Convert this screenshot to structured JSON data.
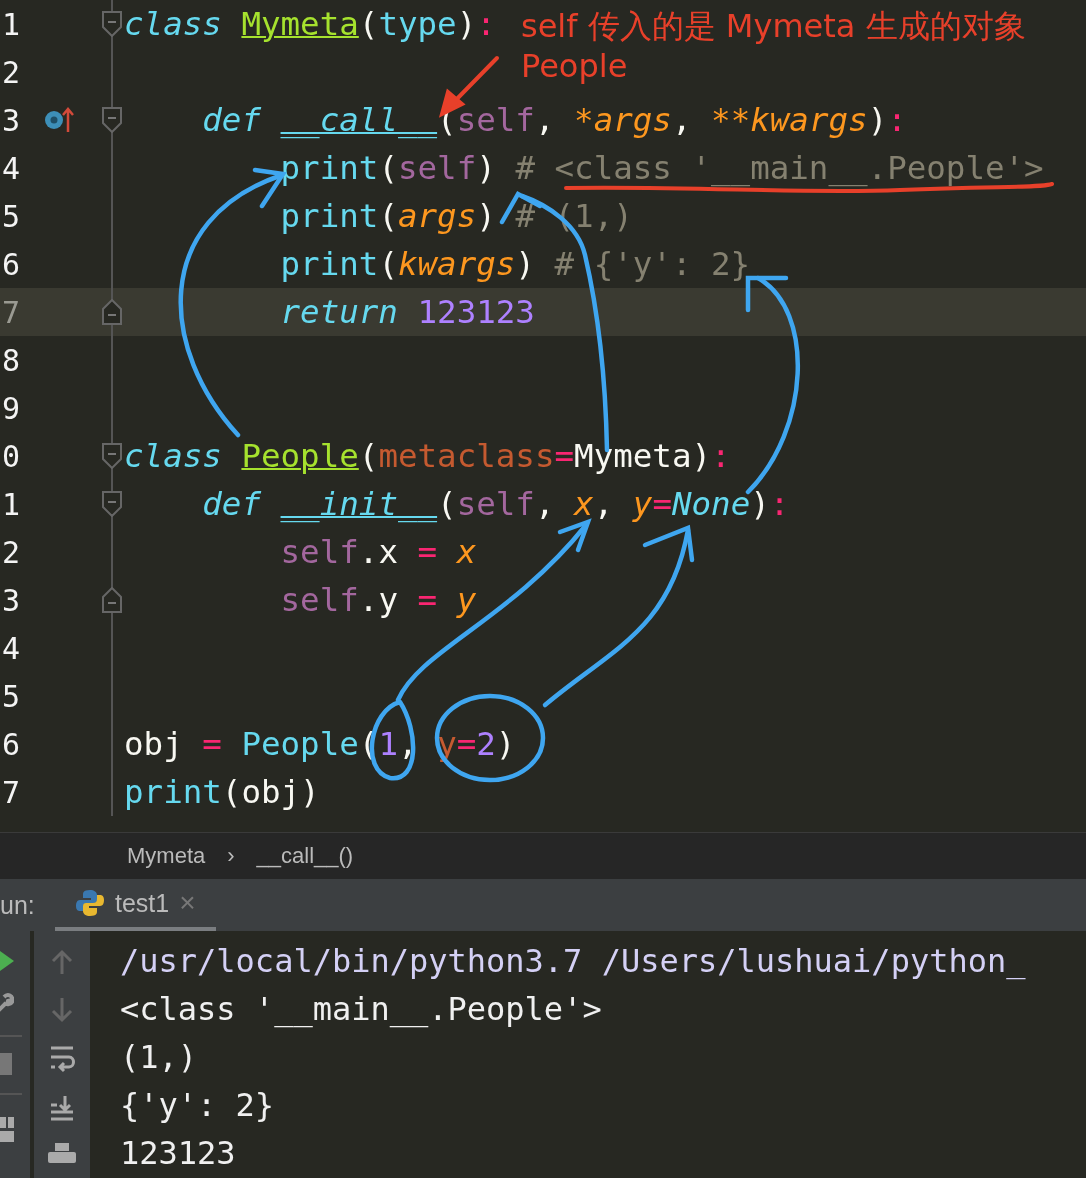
{
  "editor": {
    "lines": [
      {
        "number": "1",
        "current": false,
        "fold_start": true,
        "fold_end": false,
        "override_marker": false,
        "tokens": [
          {
            "text": "class ",
            "kind": "keyword"
          },
          {
            "text": "Mymeta",
            "kind": "classname"
          },
          {
            "text": "(",
            "kind": "plain"
          },
          {
            "text": "type",
            "kind": "builtin"
          },
          {
            "text": ")",
            "kind": "plain"
          },
          {
            "text": ":",
            "kind": "operator"
          }
        ]
      },
      {
        "number": "2",
        "current": false,
        "fold_start": false,
        "fold_end": false,
        "override_marker": false
      },
      {
        "number": "3",
        "current": false,
        "fold_start": true,
        "fold_end": false,
        "override_marker": true,
        "tokens": [
          {
            "text": "    def ",
            "kind": "keyword"
          },
          {
            "text": "__call__",
            "kind": "function"
          },
          {
            "text": "(",
            "kind": "plain"
          },
          {
            "text": "self",
            "kind": "self"
          },
          {
            "text": ", ",
            "kind": "plain"
          },
          {
            "text": "*args",
            "kind": "param"
          },
          {
            "text": ", ",
            "kind": "plain"
          },
          {
            "text": "**kwargs",
            "kind": "param"
          },
          {
            "text": ")",
            "kind": "plain"
          },
          {
            "text": ":",
            "kind": "operator"
          }
        ]
      },
      {
        "number": "4",
        "current": false,
        "fold_start": false,
        "fold_end": false,
        "override_marker": false,
        "tokens": [
          {
            "text": "        print",
            "kind": "builtin"
          },
          {
            "text": "(",
            "kind": "plain"
          },
          {
            "text": "self",
            "kind": "self"
          },
          {
            "text": ") ",
            "kind": "plain"
          },
          {
            "text": "# <class '__main__.People'>",
            "kind": "comment"
          }
        ]
      },
      {
        "number": "5",
        "current": false,
        "fold_start": false,
        "fold_end": false,
        "override_marker": false,
        "tokens": [
          {
            "text": "        print",
            "kind": "builtin"
          },
          {
            "text": "(",
            "kind": "plain"
          },
          {
            "text": "args",
            "kind": "param"
          },
          {
            "text": ") ",
            "kind": "plain"
          },
          {
            "text": "# (1,)",
            "kind": "comment"
          }
        ]
      },
      {
        "number": "6",
        "current": false,
        "fold_start": false,
        "fold_end": false,
        "override_marker": false,
        "tokens": [
          {
            "text": "        print",
            "kind": "builtin"
          },
          {
            "text": "(",
            "kind": "plain"
          },
          {
            "text": "kwargs",
            "kind": "param"
          },
          {
            "text": ") ",
            "kind": "plain"
          },
          {
            "text": "# {'y': 2}",
            "kind": "comment"
          }
        ]
      },
      {
        "number": "7",
        "current": true,
        "fold_start": false,
        "fold_end": true,
        "override_marker": false,
        "tokens": [
          {
            "text": "        return ",
            "kind": "keyword"
          },
          {
            "text": "123123",
            "kind": "number"
          }
        ]
      },
      {
        "number": "8",
        "current": false,
        "fold_start": false,
        "fold_end": false,
        "override_marker": false
      },
      {
        "number": "9",
        "current": false,
        "fold_start": false,
        "fold_end": false,
        "override_marker": false
      },
      {
        "number": "0",
        "current": false,
        "fold_start": true,
        "fold_end": false,
        "override_marker": false,
        "tokens": [
          {
            "text": "class ",
            "kind": "keyword"
          },
          {
            "text": "People",
            "kind": "classname"
          },
          {
            "text": "(",
            "kind": "plain"
          },
          {
            "text": "metaclass",
            "kind": "kwarg"
          },
          {
            "text": "=",
            "kind": "operator"
          },
          {
            "text": "Mymeta)",
            "kind": "plain"
          },
          {
            "text": ":",
            "kind": "operator"
          }
        ]
      },
      {
        "number": "1",
        "current": false,
        "fold_start": true,
        "fold_end": false,
        "override_marker": false,
        "tokens": [
          {
            "text": "    def ",
            "kind": "keyword"
          },
          {
            "text": "__init__",
            "kind": "function"
          },
          {
            "text": "(",
            "kind": "plain"
          },
          {
            "text": "self",
            "kind": "self"
          },
          {
            "text": ", ",
            "kind": "plain"
          },
          {
            "text": "x",
            "kind": "param"
          },
          {
            "text": ", ",
            "kind": "plain"
          },
          {
            "text": "y",
            "kind": "param"
          },
          {
            "text": "=",
            "kind": "operator"
          },
          {
            "text": "None",
            "kind": "constant"
          },
          {
            "text": ")",
            "kind": "plain"
          },
          {
            "text": ":",
            "kind": "operator"
          }
        ]
      },
      {
        "number": "2",
        "current": false,
        "fold_start": false,
        "fold_end": false,
        "override_marker": false,
        "tokens": [
          {
            "text": "        self",
            "kind": "self"
          },
          {
            "text": ".x ",
            "kind": "plain"
          },
          {
            "text": "= ",
            "kind": "operator"
          },
          {
            "text": "x",
            "kind": "param"
          }
        ]
      },
      {
        "number": "3",
        "current": false,
        "fold_start": false,
        "fold_end": true,
        "override_marker": false,
        "tokens": [
          {
            "text": "        self",
            "kind": "self"
          },
          {
            "text": ".y ",
            "kind": "plain"
          },
          {
            "text": "= ",
            "kind": "operator"
          },
          {
            "text": "y",
            "kind": "param"
          }
        ]
      },
      {
        "number": "4",
        "current": false,
        "fold_start": false,
        "fold_end": false,
        "override_marker": false
      },
      {
        "number": "5",
        "current": false,
        "fold_start": false,
        "fold_end": false,
        "override_marker": false
      },
      {
        "number": "6",
        "current": false,
        "fold_start": false,
        "fold_end": false,
        "override_marker": false,
        "tokens": [
          {
            "text": "obj ",
            "kind": "plain"
          },
          {
            "text": "= ",
            "kind": "operator"
          },
          {
            "text": "People",
            "kind": "builtin"
          },
          {
            "text": "(",
            "kind": "plain"
          },
          {
            "text": "1",
            "kind": "number"
          },
          {
            "text": ", ",
            "kind": "plain"
          },
          {
            "text": "y",
            "kind": "kwarg"
          },
          {
            "text": "=",
            "kind": "operator"
          },
          {
            "text": "2",
            "kind": "number"
          },
          {
            "text": ")",
            "kind": "plain"
          }
        ]
      },
      {
        "number": "7",
        "current": false,
        "fold_start": false,
        "fold_end": false,
        "override_marker": false,
        "tokens": [
          {
            "text": "print",
            "kind": "builtin"
          },
          {
            "text": "(obj)",
            "kind": "plain"
          }
        ]
      }
    ]
  },
  "annotation": {
    "lines": [
      "self 传入的是 Mymeta 生成的对象",
      "People"
    ]
  },
  "breadcrumb": {
    "items": [
      "Mymeta",
      "__call__()"
    ],
    "separator": "›"
  },
  "run_panel": {
    "label": "un:",
    "tabs": [
      {
        "label": "test1",
        "selected": true,
        "close": "×"
      }
    ],
    "console": [
      "/usr/local/bin/python3.7 /Users/lushuai/python_",
      "<class '__main__.People'>",
      "(1,)",
      "{'y': 2}",
      "123123"
    ]
  }
}
